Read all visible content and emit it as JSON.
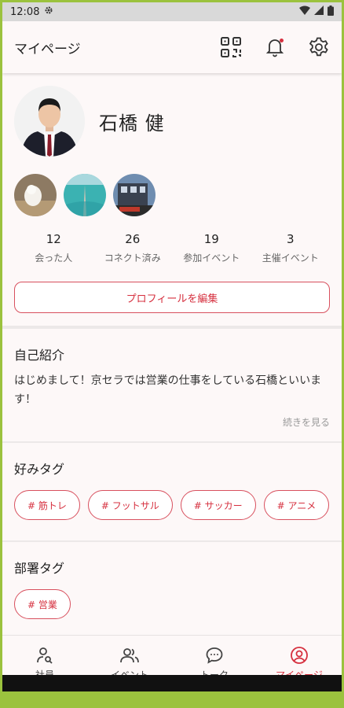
{
  "status": {
    "time": "12:08"
  },
  "header": {
    "title": "マイページ"
  },
  "profile": {
    "name": "石橋 健",
    "stats": [
      {
        "value": "12",
        "label": "会った人"
      },
      {
        "value": "26",
        "label": "コネクト済み"
      },
      {
        "value": "19",
        "label": "参加イベント"
      },
      {
        "value": "3",
        "label": "主催イベント"
      }
    ],
    "edit_label": "プロフィールを編集"
  },
  "intro": {
    "heading": "自己紹介",
    "text": "はじめまして！京セラでは営業の仕事をしている石橋といいます！",
    "more": "続きを見る"
  },
  "favorite_tags": {
    "heading": "好みタグ",
    "tags": [
      "# 筋トレ",
      "# フットサル",
      "# サッカー",
      "# アニメ"
    ]
  },
  "department_tags": {
    "heading": "部署タグ",
    "tags": [
      "# 営業"
    ]
  },
  "nav": {
    "items": [
      {
        "label": "社員"
      },
      {
        "label": "イベント"
      },
      {
        "label": "トーク"
      },
      {
        "label": "マイページ"
      }
    ]
  },
  "colors": {
    "accent": "#d6303f",
    "background": "#fdf8f8",
    "frame": "#9bc23e"
  }
}
